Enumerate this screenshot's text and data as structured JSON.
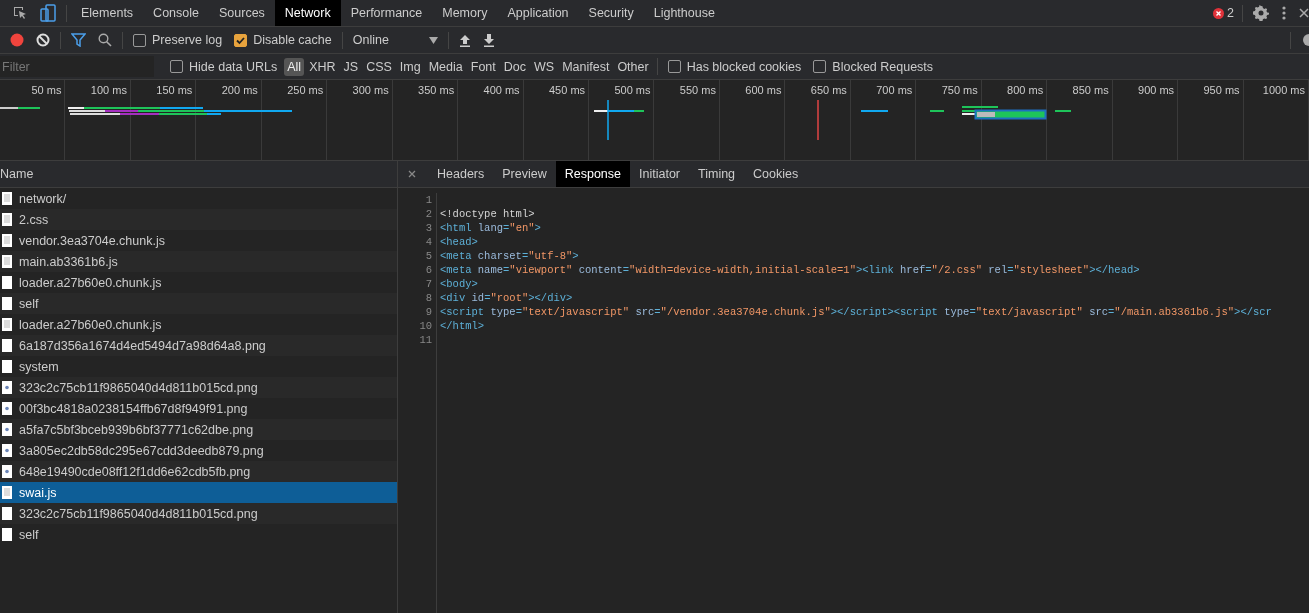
{
  "panel_tabs": [
    {
      "label": "Elements",
      "selected": false
    },
    {
      "label": "Console",
      "selected": false
    },
    {
      "label": "Sources",
      "selected": false
    },
    {
      "label": "Network",
      "selected": true
    },
    {
      "label": "Performance",
      "selected": false
    },
    {
      "label": "Memory",
      "selected": false
    },
    {
      "label": "Application",
      "selected": false
    },
    {
      "label": "Security",
      "selected": false
    },
    {
      "label": "Lighthouse",
      "selected": false
    }
  ],
  "error_count": "2",
  "toolbar": {
    "recording": true,
    "preserve_log": {
      "label": "Preserve log",
      "checked": false
    },
    "disable_cache": {
      "label": "Disable cache",
      "checked": true
    },
    "throttling": "Online"
  },
  "filter_bar": {
    "placeholder": "Filter",
    "hide_data_urls": {
      "label": "Hide data URLs",
      "checked": false
    },
    "types": [
      {
        "label": "All",
        "selected": true
      },
      {
        "label": "XHR",
        "selected": false
      },
      {
        "label": "JS",
        "selected": false
      },
      {
        "label": "CSS",
        "selected": false
      },
      {
        "label": "Img",
        "selected": false
      },
      {
        "label": "Media",
        "selected": false
      },
      {
        "label": "Font",
        "selected": false
      },
      {
        "label": "Doc",
        "selected": false
      },
      {
        "label": "WS",
        "selected": false
      },
      {
        "label": "Manifest",
        "selected": false
      },
      {
        "label": "Other",
        "selected": false
      }
    ],
    "has_blocked_cookies": {
      "label": "Has blocked cookies",
      "checked": false
    },
    "blocked_requests": {
      "label": "Blocked Requests",
      "checked": false
    }
  },
  "overview_ticks": [
    "50 ms",
    "100 ms",
    "150 ms",
    "200 ms",
    "250 ms",
    "300 ms",
    "350 ms",
    "400 ms",
    "450 ms",
    "500 ms",
    "550 ms",
    "600 ms",
    "650 ms",
    "700 ms",
    "750 ms",
    "800 ms",
    "850 ms",
    "900 ms",
    "950 ms",
    "1000 ms"
  ],
  "requests": {
    "column": "Name",
    "rows": [
      {
        "name": "network/",
        "kind": "document",
        "selected": false
      },
      {
        "name": "2.css",
        "kind": "document",
        "selected": false
      },
      {
        "name": "vendor.3ea3704e.chunk.js",
        "kind": "document",
        "selected": false
      },
      {
        "name": "main.ab3361b6.js",
        "kind": "document",
        "selected": false
      },
      {
        "name": "loader.a27b60e0.chunk.js",
        "kind": "blank",
        "selected": false
      },
      {
        "name": "self",
        "kind": "blank",
        "selected": false
      },
      {
        "name": "loader.a27b60e0.chunk.js",
        "kind": "document",
        "selected": false
      },
      {
        "name": "6a187d356a1674d4ed5494d7a98d64a8.png",
        "kind": "blank",
        "selected": false
      },
      {
        "name": "system",
        "kind": "blank",
        "selected": false
      },
      {
        "name": "323c2c75cb11f9865040d4d811b015cd.png",
        "kind": "image",
        "selected": false
      },
      {
        "name": "00f3bc4818a0238154ffb67d8f949f91.png",
        "kind": "image",
        "selected": false
      },
      {
        "name": "a5fa7c5bf3bceb939b6bf37771c62dbe.png",
        "kind": "image",
        "selected": false
      },
      {
        "name": "3a805ec2db58dc295e67cdd3deedb879.png",
        "kind": "image",
        "selected": false
      },
      {
        "name": "648e19490cde08ff12f1dd6e62cdb5fb.png",
        "kind": "image",
        "selected": false
      },
      {
        "name": "swai.js",
        "kind": "document",
        "selected": true
      },
      {
        "name": "323c2c75cb11f9865040d4d811b015cd.png",
        "kind": "blank",
        "selected": false
      },
      {
        "name": "self",
        "kind": "blank",
        "selected": false
      }
    ]
  },
  "detail_tabs": [
    {
      "label": "Headers",
      "selected": false
    },
    {
      "label": "Preview",
      "selected": false
    },
    {
      "label": "Response",
      "selected": true
    },
    {
      "label": "Initiator",
      "selected": false
    },
    {
      "label": "Timing",
      "selected": false
    },
    {
      "label": "Cookies",
      "selected": false
    }
  ],
  "response_lines": [
    {
      "number": "1"
    },
    {
      "number": "2",
      "tokens": [
        {
          "kind": "doctype",
          "text": "<!doctype html>"
        }
      ]
    },
    {
      "number": "3",
      "tokens": [
        {
          "kind": "tag",
          "text": "<html "
        },
        {
          "kind": "attr",
          "text": "lang"
        },
        {
          "kind": "tag",
          "text": "="
        },
        {
          "kind": "value",
          "text": "\"en\""
        },
        {
          "kind": "tag",
          "text": ">"
        }
      ]
    },
    {
      "number": "4",
      "tokens": [
        {
          "kind": "tag",
          "text": "<head>"
        }
      ]
    },
    {
      "number": "5",
      "tokens": [
        {
          "kind": "tag",
          "text": "<meta "
        },
        {
          "kind": "attr",
          "text": "charset"
        },
        {
          "kind": "tag",
          "text": "="
        },
        {
          "kind": "value",
          "text": "\"utf-8\""
        },
        {
          "kind": "tag",
          "text": ">"
        }
      ]
    },
    {
      "number": "6",
      "tokens": [
        {
          "kind": "tag",
          "text": "<meta "
        },
        {
          "kind": "attr",
          "text": "name"
        },
        {
          "kind": "tag",
          "text": "="
        },
        {
          "kind": "value",
          "text": "\"viewport\""
        },
        {
          "kind": "attr",
          "text": " content"
        },
        {
          "kind": "tag",
          "text": "="
        },
        {
          "kind": "value",
          "text": "\"width=device-width,initial-scale=1\""
        },
        {
          "kind": "tag",
          "text": "><link "
        },
        {
          "kind": "attr",
          "text": "href"
        },
        {
          "kind": "tag",
          "text": "="
        },
        {
          "kind": "value",
          "text": "\"/2.css\""
        },
        {
          "kind": "attr",
          "text": " rel"
        },
        {
          "kind": "tag",
          "text": "="
        },
        {
          "kind": "value",
          "text": "\"stylesheet\""
        },
        {
          "kind": "tag",
          "text": "></head>"
        }
      ]
    },
    {
      "number": "7",
      "tokens": [
        {
          "kind": "tag",
          "text": "<body>"
        }
      ]
    },
    {
      "number": "8",
      "tokens": [
        {
          "kind": "tag",
          "text": "<div "
        },
        {
          "kind": "attr",
          "text": "id"
        },
        {
          "kind": "tag",
          "text": "="
        },
        {
          "kind": "value",
          "text": "\"root\""
        },
        {
          "kind": "tag",
          "text": "></div>"
        }
      ]
    },
    {
      "number": "9",
      "tokens": [
        {
          "kind": "tag",
          "text": "<script "
        },
        {
          "kind": "attr",
          "text": "type"
        },
        {
          "kind": "tag",
          "text": "="
        },
        {
          "kind": "value",
          "text": "\"text/javascript\""
        },
        {
          "kind": "attr",
          "text": " src"
        },
        {
          "kind": "tag",
          "text": "="
        },
        {
          "kind": "value",
          "text": "\"/vendor.3ea3704e.chunk.js\""
        },
        {
          "kind": "tag",
          "text": "></script><script "
        },
        {
          "kind": "attr",
          "text": "type"
        },
        {
          "kind": "tag",
          "text": "="
        },
        {
          "kind": "value",
          "text": "\"text/javascript\""
        },
        {
          "kind": "attr",
          "text": " src"
        },
        {
          "kind": "tag",
          "text": "="
        },
        {
          "kind": "value",
          "text": "\"/main.ab3361b6.js\""
        },
        {
          "kind": "tag",
          "text": "></scr"
        }
      ]
    },
    {
      "number": "10",
      "tokens": [
        {
          "kind": "tag",
          "text": "</html>"
        }
      ]
    },
    {
      "number": "11"
    }
  ]
}
